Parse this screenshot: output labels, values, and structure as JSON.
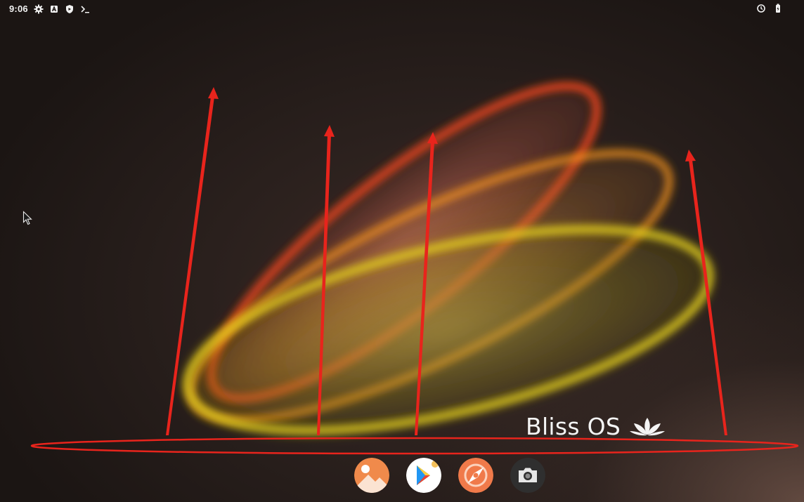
{
  "statusbar": {
    "time": "9:06",
    "left_icons": [
      "gear-icon",
      "store-icon",
      "shield-icon",
      "terminal-icon"
    ],
    "right_icons": [
      "sync-icon",
      "battery-icon"
    ]
  },
  "branding": {
    "name": "Bliss OS",
    "logo": "lotus-icon"
  },
  "dock": {
    "apps": [
      {
        "name": "gallery-app-icon",
        "color": "#f08a4b"
      },
      {
        "name": "play-store-app-icon",
        "color": "#ffffff"
      },
      {
        "name": "browser-app-icon",
        "color": "#f07a4a"
      },
      {
        "name": "camera-app-icon",
        "color": "#2f2f2f"
      }
    ]
  },
  "colors": {
    "annotation_red": "#e8241c",
    "ring_red": "#ff4a1c",
    "ring_orange": "#ff9a1a",
    "ring_yellow": "#e6d21a"
  }
}
